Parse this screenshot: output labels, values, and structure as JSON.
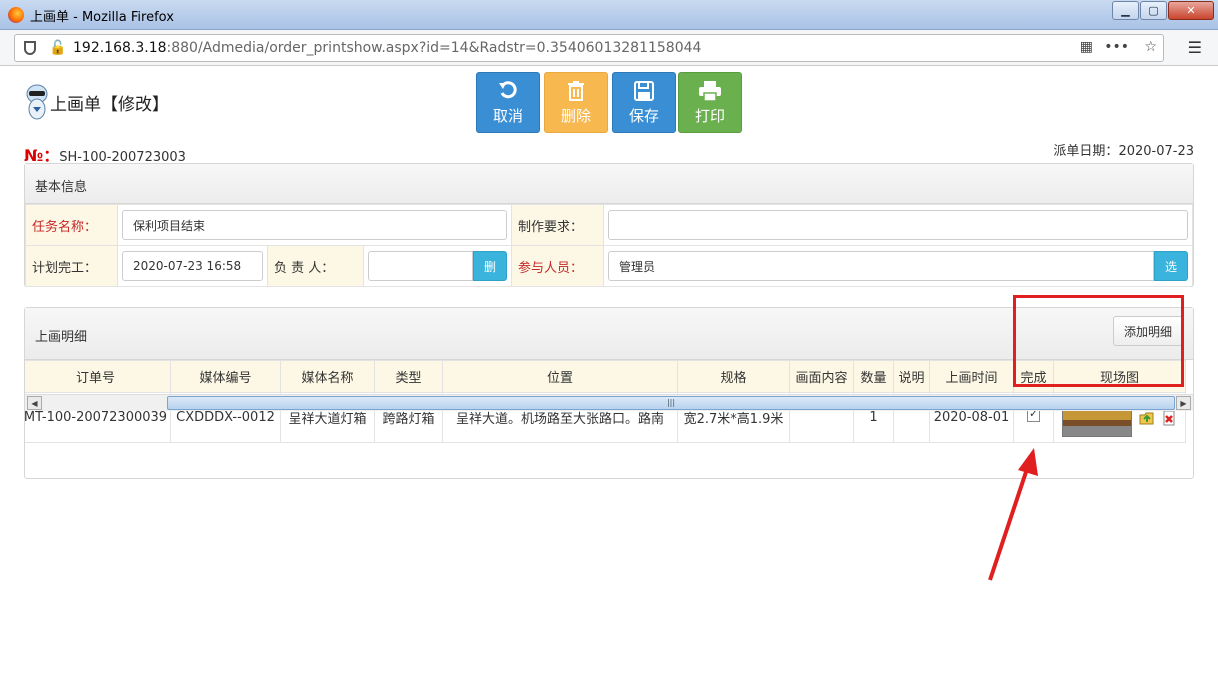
{
  "window": {
    "title": "上画单 - Mozilla Firefox"
  },
  "browser": {
    "url_host": "192.168.3.18",
    "url_rest": ":880/Admedia/order_printshow.aspx?id=14&Radstr=0.35406013281158044"
  },
  "page": {
    "title": "上画单【修改】",
    "no_label": "№：",
    "no_value": "SH-100-200723003",
    "date_label": "派单日期：",
    "date_value": "2020-07-23"
  },
  "toolbar": {
    "cancel": "取消",
    "delete": "删除",
    "save": "保存",
    "print": "打印"
  },
  "basic": {
    "heading": "基本信息",
    "task_label": "任务名称：",
    "task_value": "保利项目结束",
    "req_label": "制作要求：",
    "req_value": "",
    "plan_label": "计划完工：",
    "plan_value": "2020-07-23 16:58",
    "owner_label": "负 责 人：",
    "owner_value": "",
    "owner_btn": "删",
    "members_label": "参与人员：",
    "members_value": "管理员",
    "members_btn": "选"
  },
  "detail": {
    "heading": "上画明细",
    "add_btn": "添加明细",
    "columns": [
      "订单号",
      "媒体编号",
      "媒体名称",
      "类型",
      "位置",
      "规格",
      "画面内容",
      "数量",
      "说明",
      "上画时间",
      "完成",
      "现场图"
    ],
    "row": {
      "order_no": "MT-100-20072300039",
      "media_no": "CXDDDX--0012",
      "media_name": "呈祥大道灯箱",
      "type": "跨路灯箱",
      "location": "呈祥大道。机场路至大张路口。路南",
      "spec": "宽2.7米*高1.9米",
      "content": "",
      "qty": "1",
      "note": "",
      "time": "2020-08-01",
      "done": true
    }
  },
  "colors": {
    "blue": "#3a8fd4",
    "orange": "#f7b850",
    "green": "#6bb04f",
    "highlight": "#e02020"
  }
}
